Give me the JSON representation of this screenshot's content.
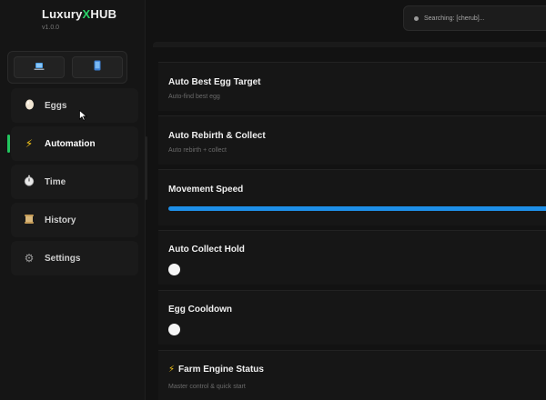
{
  "app": {
    "title_prefix": "Luxury",
    "title_x": "X",
    "title_suffix": "HUB",
    "version": "v1.0.0"
  },
  "search": {
    "text": "Searching: [cherub]..."
  },
  "device_buttons": [
    {
      "icon": "laptop-icon"
    },
    {
      "icon": "phone-icon"
    }
  ],
  "nav": [
    {
      "label": "Eggs",
      "icon": "egg-icon",
      "glyph": "🥚"
    },
    {
      "label": "Automation",
      "icon": "lightning-icon",
      "glyph": "⚡"
    },
    {
      "label": "Time",
      "icon": "stopwatch-icon",
      "glyph": "⏱"
    },
    {
      "label": "History",
      "icon": "scroll-icon",
      "glyph": "📜"
    },
    {
      "label": "Settings",
      "icon": "gear-icon",
      "glyph": "⚙"
    }
  ],
  "active_nav": "Automation",
  "accent_colors": {
    "active": "#22c55e",
    "slider": "#1e8fe8",
    "logo_x": "#2bd46a"
  },
  "options": [
    {
      "title": "Auto Best Egg Target",
      "subtitle": "Auto-find best egg"
    },
    {
      "title": "Auto Rebirth & Collect",
      "subtitle": "Auto rebirth + collect"
    },
    {
      "title": "Movement Speed",
      "slider_value_percent": 100
    },
    {
      "title": "Auto Collect Hold",
      "toggle": "off"
    },
    {
      "title": "Egg Cooldown",
      "toggle": "off"
    },
    {
      "title": "Farm Engine Status",
      "subtitle": "Master control & quick start",
      "icon_glyph": "⚡"
    }
  ]
}
